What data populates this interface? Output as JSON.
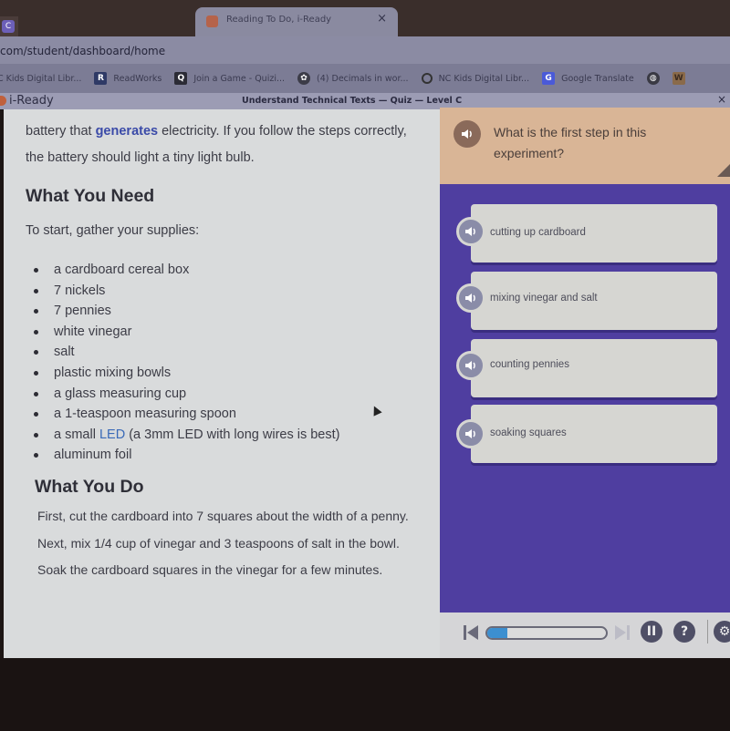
{
  "browser": {
    "tab_small_letter": "C",
    "active_tab_title": "Reading To Do, i-Ready",
    "tab_close": "×",
    "url": "com/student/dashboard/home",
    "bookmarks": [
      {
        "label": "C Kids Digital Libr...",
        "icon": "bookmark-icon"
      },
      {
        "label": "ReadWorks",
        "icon": "readworks-icon",
        "glyph": "R"
      },
      {
        "label": "Join a Game - Quizi...",
        "icon": "quizizz-icon",
        "glyph": "Q"
      },
      {
        "label": "(4) Decimals in wor...",
        "icon": "khan-academy-icon",
        "glyph": "✿"
      },
      {
        "label": "NC Kids Digital Libr...",
        "icon": "circle-icon",
        "glyph": "O"
      },
      {
        "label": "Google Translate",
        "icon": "google-translate-icon",
        "glyph": "G"
      },
      {
        "label": "",
        "icon": "globe-icon",
        "glyph": "◍"
      },
      {
        "label": "",
        "icon": "w-icon",
        "glyph": "W"
      }
    ]
  },
  "app": {
    "logo": "i-Ready",
    "lesson_title": "Understand Technical Texts — Quiz — Level C",
    "close": "×"
  },
  "reading": {
    "intro_before": "battery that ",
    "intro_keyword": "generates",
    "intro_after": " electricity. If you follow the steps correctly, the battery should light a tiny light bulb.",
    "heading_need": "What You Need",
    "gather": "To start, gather your supplies:",
    "supplies": [
      "a cardboard cereal box",
      "7 nickels",
      "7 pennies",
      "white vinegar",
      "salt",
      "plastic mixing bowls",
      "a glass measuring cup",
      "a 1-teaspoon measuring spoon",
      "a small ",
      "aluminum foil"
    ],
    "led_keyword": "LED",
    "led_after": " (a 3mm LED with long wires is best)",
    "heading_do": "What You Do",
    "steps_text": "First, cut the cardboard into 7 squares about the width of a penny. Next, mix 1/4 cup of vinegar and 3 teaspoons of salt in the bowl. Soak the cardboard squares in the vinegar for a few minutes."
  },
  "quiz": {
    "question": "What is the first step in this experiment?",
    "answers": [
      {
        "label": "cutting up cardboard"
      },
      {
        "label": "mixing vinegar and salt"
      },
      {
        "label": "counting pennies"
      },
      {
        "label": "soaking squares"
      }
    ],
    "progress_percent": 17,
    "pause_glyph": "II",
    "help_glyph": "?",
    "settings_glyph": "⚙"
  },
  "colors": {
    "accent_purple": "#4f3ea0",
    "question_bg": "#d9b596",
    "keyword_blue": "#3a4aa8",
    "progress_blue": "#3c8fd0"
  }
}
